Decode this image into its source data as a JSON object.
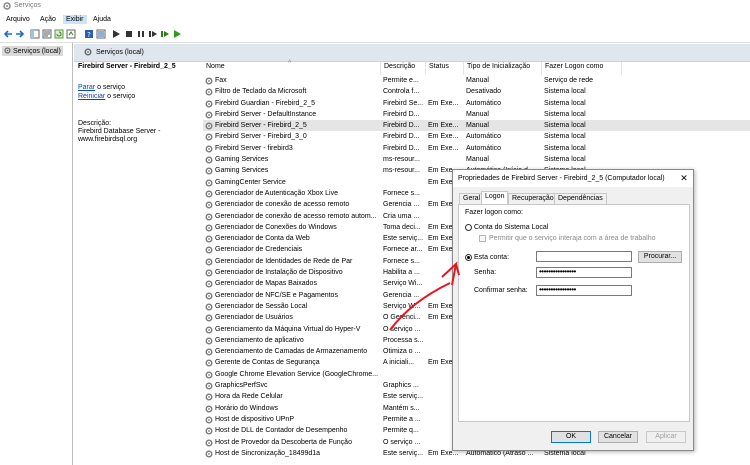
{
  "window": {
    "title": "Serviços"
  },
  "menu": [
    "Arquivo",
    "Ação",
    "Exibir",
    "Ajuda"
  ],
  "left_pane": {
    "item": "Serviços (local)"
  },
  "header": {
    "title": "Serviços (local)"
  },
  "details": {
    "service_title": "Firebird Server - Firebird_2_5",
    "stop_link": "Parar",
    "stop_suffix": " o serviço",
    "restart_link": "Reiniciar",
    "restart_suffix": " o serviço",
    "description_label": "Descrição:",
    "description_text": "Firebird Database Server - www.firebirdsql.org"
  },
  "columns": {
    "name": "Nome",
    "description": "Descrição",
    "status": "Status",
    "startup": "Tipo de Inicialização",
    "logon": "Fazer Logon como"
  },
  "services": [
    [
      "Fax",
      "Permite e...",
      "",
      "Manual",
      "Serviço de rede"
    ],
    [
      "Filtro de Teclado da Microsoft",
      "Controla f...",
      "",
      "Desativado",
      "Sistema local"
    ],
    [
      "Firebird Guardian - Firebird_2_5",
      "Firebird Se...",
      "Em Exe...",
      "Automático",
      "Sistema local"
    ],
    [
      "Firebird Server - DefaultInstance",
      "Firebird D...",
      "",
      "Manual",
      "Sistema local"
    ],
    [
      "Firebird Server - Firebird_2_5",
      "Firebird D...",
      "Em Exe...",
      "Manual",
      "Sistema local"
    ],
    [
      "Firebird Server - Firebird_3_0",
      "Firebird D...",
      "Em Exe...",
      "Automático",
      "Sistema local"
    ],
    [
      "Firebird Server - firebird3",
      "Firebird D...",
      "Em Exe...",
      "Automático",
      "Sistema local"
    ],
    [
      "Gaming Services",
      "ms-resour...",
      "",
      "Manual",
      "Sistema local"
    ],
    [
      "Gaming Services",
      "ms-resour...",
      "Em Exe...",
      "Automático (Início d...",
      "Sistema local"
    ],
    [
      "GamingCenter Service",
      "",
      "Em Exe...",
      "",
      ""
    ],
    [
      "Gerenciador de Autenticação Xbox Live",
      "Fornece s...",
      "",
      "",
      ""
    ],
    [
      "Gerenciador de conexão de acesso remoto",
      "Gerencia ...",
      "Em Exe...",
      "",
      ""
    ],
    [
      "Gerenciador de conexão de acesso remoto autom...",
      "Cria uma ...",
      "",
      "",
      ""
    ],
    [
      "Gerenciador de Conexões do Windows",
      "Toma deci...",
      "Em Exe...",
      "",
      ""
    ],
    [
      "Gerenciador de Conta da Web",
      "Este serviç...",
      "Em Exe...",
      "",
      ""
    ],
    [
      "Gerenciador de Credenciais",
      "Fornece ar...",
      "Em Exe...",
      "",
      ""
    ],
    [
      "Gerenciador de Identidades de Rede de Par",
      "Fornece s...",
      "",
      "",
      ""
    ],
    [
      "Gerenciador de Instalação de Dispositivo",
      "Habilita a ...",
      "",
      "",
      ""
    ],
    [
      "Gerenciador de Mapas Baixados",
      "Serviço Wi...",
      "",
      "",
      ""
    ],
    [
      "Gerenciador de NFC/SE e Pagamentos",
      "Gerencia ...",
      "",
      "",
      ""
    ],
    [
      "Gerenciador de Sessão Local",
      "Serviço W...",
      "Em Exe...",
      "",
      ""
    ],
    [
      "Gerenciador de Usuários",
      "O Gerenci...",
      "Em Exe...",
      "",
      ""
    ],
    [
      "Gerenciamento da Máquina Virtual do Hyper-V",
      "O serviço ...",
      "",
      "",
      ""
    ],
    [
      "Gerenciamento de aplicativo",
      "Processa s...",
      "",
      "",
      ""
    ],
    [
      "Gerenciamento de Camadas de Armazenamento",
      "Otimiza o ...",
      "",
      "",
      ""
    ],
    [
      "Gerente de Contas de Segurança",
      "A iniciali...",
      "Em Exe...",
      "",
      ""
    ],
    [
      "Google Chrome Elevation Service (GoogleChrome...",
      "",
      "",
      "",
      ""
    ],
    [
      "GraphicsPerfSvc",
      "Graphics ...",
      "",
      "",
      ""
    ],
    [
      "Hora da Rede Celular",
      "Este serviç...",
      "",
      "",
      ""
    ],
    [
      "Horário do Windows",
      "Mantém s...",
      "",
      "",
      ""
    ],
    [
      "Host de dispositivo UPnP",
      "Permite a ...",
      "",
      "",
      ""
    ],
    [
      "Host de DLL de Contador de Desempenho",
      "Permite q...",
      "",
      "",
      ""
    ],
    [
      "Host de Provedor da Descoberta de Função",
      "O serviço ...",
      "",
      "",
      ""
    ],
    [
      "Host de Sincronização_18499d1a",
      "Este serviç...",
      "Em Exe...",
      "Automático (Atraso ...",
      "Sistema local"
    ]
  ],
  "dialog": {
    "title": "Propriedades de Firebird Server - Firebird_2_5 (Computador local)",
    "close": "✕",
    "tabs": [
      "Geral",
      "Logon",
      "Recuperação",
      "Dependências"
    ],
    "logon_as_label": "Fazer logon como:",
    "local_system_label": "Conta do Sistema Local",
    "interact_label": "Permitir que o serviço interaja com a área de trabalho",
    "this_account_label": "Esta conta:",
    "account_value": "",
    "browse_button": "Procurar...",
    "password_label": "Senha:",
    "password_value": "••••••••••••••••",
    "confirm_label": "Confirmar senha:",
    "confirm_value": "••••••••••••••••",
    "ok": "OK",
    "cancel": "Cancelar",
    "apply": "Aplicar",
    "selected_option": "this_account"
  },
  "annotation": {
    "color": "#e8141e"
  },
  "colors": {
    "selection": "#e5e5e5",
    "header_band": "#dfe6ee",
    "link": "#0645ad",
    "accent": "#0078d7"
  }
}
